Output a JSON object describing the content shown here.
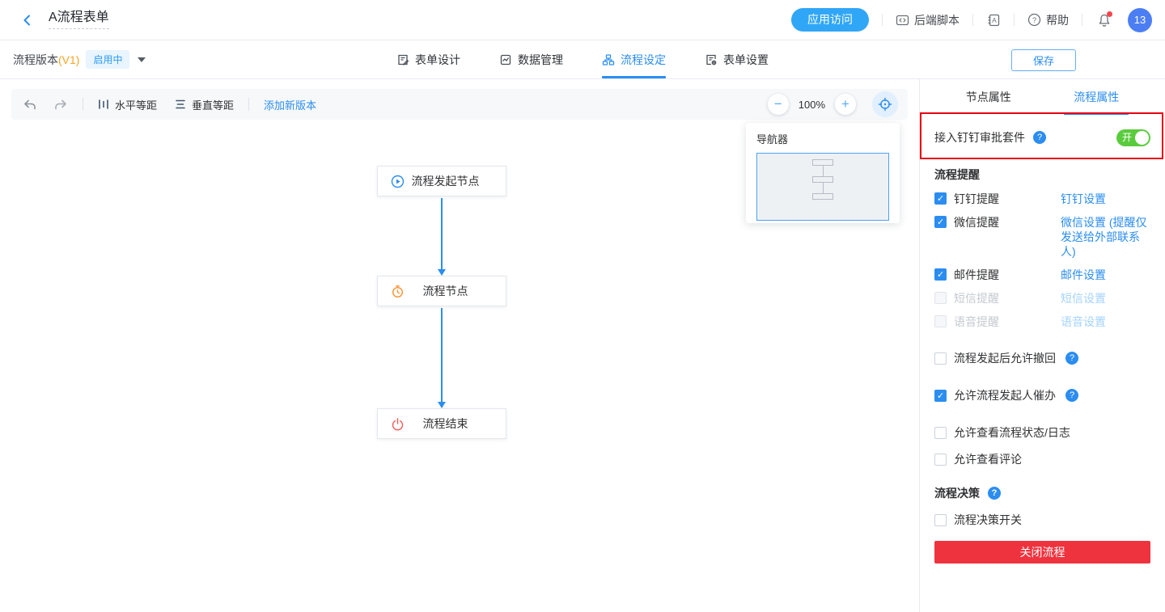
{
  "header": {
    "title": "A流程表单",
    "app_access_button": "应用访问",
    "backend_script": "后端脚本",
    "help": "帮助",
    "notification_badge": "13"
  },
  "version_bar": {
    "label": "流程版本",
    "version": "(V1)",
    "status_badge": "启用中",
    "tabs": [
      {
        "label": "表单设计"
      },
      {
        "label": "数据管理"
      },
      {
        "label": "流程设定",
        "active": true
      },
      {
        "label": "表单设置"
      }
    ],
    "save_button": "保存"
  },
  "toolbar": {
    "horizontal_spacing": "水平等距",
    "vertical_spacing": "垂直等距",
    "add_version": "添加新版本",
    "zoom_level": "100%"
  },
  "canvas": {
    "nodes": [
      {
        "label": "流程发起节点",
        "icon": "play-circle"
      },
      {
        "label": "流程节点",
        "icon": "timer"
      },
      {
        "label": "流程结束",
        "icon": "power"
      }
    ],
    "navigator": {
      "title": "导航器"
    }
  },
  "panel": {
    "tabs": [
      {
        "label": "节点属性"
      },
      {
        "label": "流程属性",
        "active": true
      }
    ],
    "dingtalk_suite_label": "接入钉钉审批套件",
    "toggle_label": "开",
    "toggle_state": "on",
    "reminder_section": {
      "title": "流程提醒",
      "items": [
        {
          "label": "钉钉提醒",
          "link": "钉钉设置",
          "checked": true,
          "disabled": false
        },
        {
          "label": "微信提醒",
          "link": "微信设置 (提醒仅发送给外部联系人)",
          "checked": true,
          "disabled": false
        },
        {
          "label": "邮件提醒",
          "link": "邮件设置",
          "checked": true,
          "disabled": false
        },
        {
          "label": "短信提醒",
          "link": "短信设置",
          "checked": false,
          "disabled": true
        },
        {
          "label": "语音提醒",
          "link": "语音设置",
          "checked": false,
          "disabled": true
        }
      ]
    },
    "options": [
      {
        "label": "流程发起后允许撤回",
        "checked": false,
        "help": true
      },
      {
        "label": "允许流程发起人催办",
        "checked": true,
        "help": true
      },
      {
        "label": "允许查看流程状态/日志",
        "checked": false,
        "help": false
      },
      {
        "label": "允许查看评论",
        "checked": false,
        "help": false
      }
    ],
    "decision_section": {
      "title": "流程决策",
      "switch_label": "流程决策开关"
    },
    "close_button": "关闭流程"
  },
  "colors": {
    "primary_blue": "#2b8df0",
    "accent_sky": "#30a6f7",
    "toggle_green": "#5bcb3e",
    "danger_red": "#ef333e",
    "annotation_red": "#e60012",
    "version_orange": "#f5a623"
  }
}
